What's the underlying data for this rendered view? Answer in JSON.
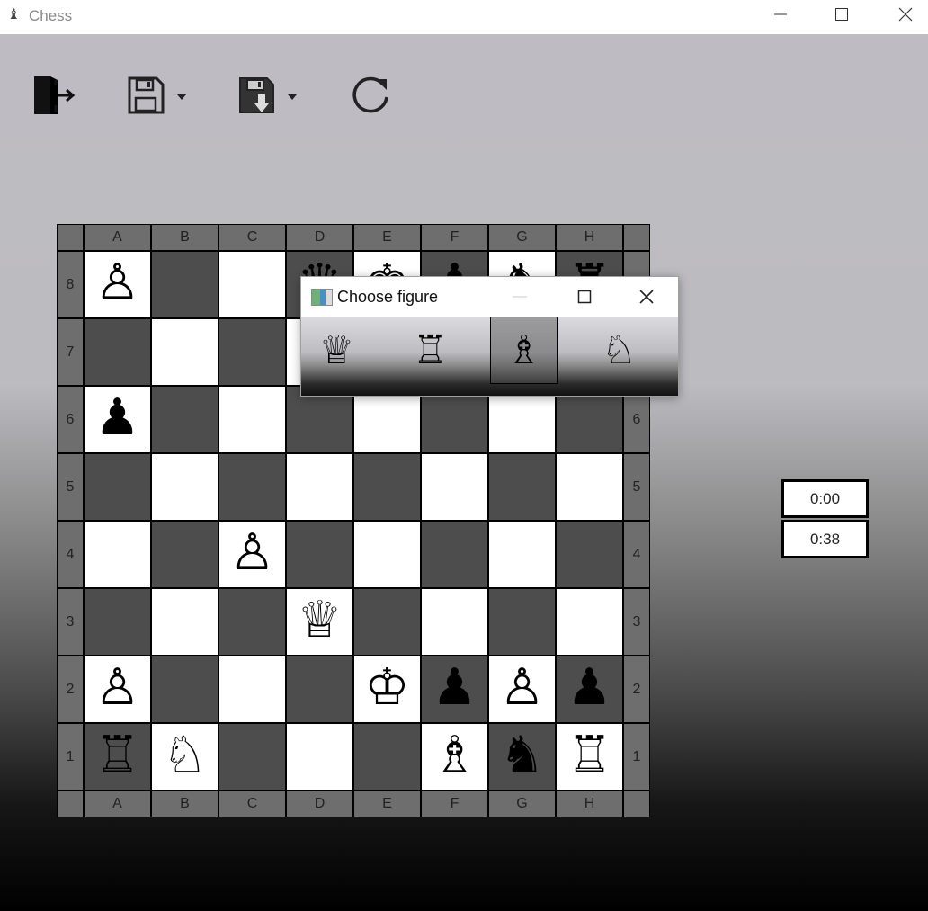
{
  "window": {
    "title": "Chess",
    "app_icon": "♝"
  },
  "toolbar": {
    "exit": {
      "icon": "exit-door-icon"
    },
    "save": {
      "icon": "floppy-disk-icon",
      "dropdown_icon": "caret-down-icon"
    },
    "load": {
      "icon": "floppy-load-icon",
      "dropdown_icon": "caret-down-icon"
    },
    "restart": {
      "icon": "refresh-icon"
    }
  },
  "board": {
    "files": [
      "A",
      "B",
      "C",
      "D",
      "E",
      "F",
      "G",
      "H"
    ],
    "ranks": [
      "8",
      "7",
      "6",
      "5",
      "4",
      "3",
      "2",
      "1"
    ],
    "rows": [
      [
        "♙",
        "",
        "",
        "♛",
        "♚",
        "♟",
        "♞",
        "♜"
      ],
      [
        "",
        "",
        "",
        "",
        "",
        "",
        "",
        ""
      ],
      [
        "♟",
        "",
        "",
        "",
        "",
        "",
        "",
        ""
      ],
      [
        "",
        "",
        "",
        "",
        "",
        "",
        "",
        ""
      ],
      [
        "",
        "",
        "♙",
        "",
        "",
        "",
        "",
        ""
      ],
      [
        "",
        "",
        "",
        "♕",
        "",
        "",
        "",
        ""
      ],
      [
        "♙",
        "",
        "",
        "",
        "♔",
        "♟",
        "♙",
        "♟"
      ],
      [
        "♖",
        "♘",
        "",
        "",
        "",
        "♗",
        "♞",
        "♖"
      ]
    ],
    "colors": {
      "light": "#ffffff",
      "dark": "#4d4d4d",
      "edge": "#6e6e6e"
    }
  },
  "timers": {
    "top": "0:00",
    "bottom": "0:38"
  },
  "dialog": {
    "title": "Choose figure",
    "choices": [
      {
        "name": "queen",
        "glyph": "♕",
        "selected": false
      },
      {
        "name": "rook",
        "glyph": "♖",
        "selected": false
      },
      {
        "name": "bishop",
        "glyph": "♗",
        "selected": true
      },
      {
        "name": "knight",
        "glyph": "♘",
        "selected": false
      }
    ]
  }
}
